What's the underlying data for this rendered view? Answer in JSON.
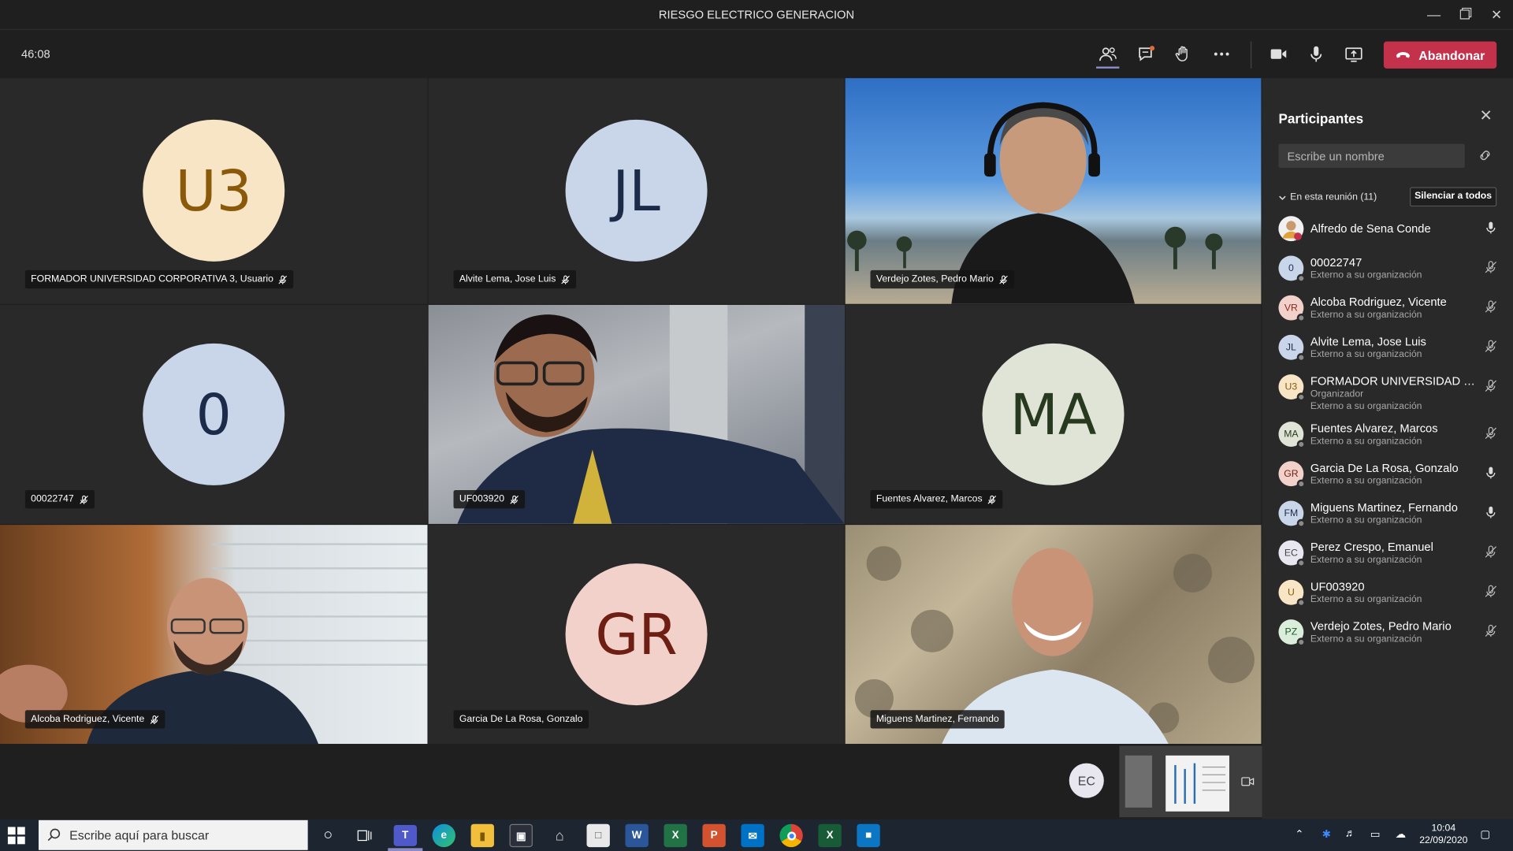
{
  "window": {
    "title": "RIESGO ELECTRICO GENERACION"
  },
  "meeting": {
    "timer": "46:08",
    "leave_label": "Abandonar"
  },
  "tiles": [
    {
      "name": "FORMADOR UNIVERSIDAD CORPORATIVA 3, Usuario",
      "initials": "U3",
      "bg": "#f7e5c5",
      "fg": "#8a5a0a",
      "type": "avatar",
      "muted": true
    },
    {
      "name": "Alvite Lema, Jose Luis",
      "initials": "JL",
      "bg": "#c9d6ea",
      "fg": "#1d2b4a",
      "type": "avatar",
      "muted": true
    },
    {
      "name": "Verdejo Zotes, Pedro Mario",
      "type": "video",
      "muted": true
    },
    {
      "name": "00022747",
      "initials": "0",
      "bg": "#c9d6ea",
      "fg": "#1d2b4a",
      "type": "avatar",
      "muted": true
    },
    {
      "name": "UF003920",
      "type": "video",
      "muted": true
    },
    {
      "name": "Fuentes Alvarez, Marcos",
      "initials": "MA",
      "bg": "#dfe4d7",
      "fg": "#27391e",
      "type": "avatar",
      "muted": true
    },
    {
      "name": "Alcoba Rodriguez, Vicente",
      "type": "video",
      "muted": true
    },
    {
      "name": "Garcia De La Rosa, Gonzalo",
      "initials": "GR",
      "bg": "#f2d1cb",
      "fg": "#6e1e12",
      "type": "avatar",
      "muted": false
    },
    {
      "name": "Miguens Martinez, Fernando",
      "type": "video",
      "muted": false
    }
  ],
  "strip": {
    "self_initials": "EC"
  },
  "panel": {
    "title": "Participantes",
    "search_placeholder": "Escribe un nombre",
    "in_meeting": "En esta reunión (11)",
    "mute_all": "Silenciar a todos",
    "participants": [
      {
        "name": "Alfredo de Sena Conde",
        "initials": "",
        "bg": "#f3f3f3",
        "fg": "#333",
        "subtitle": "",
        "subtitle2": "",
        "muted": false,
        "photo": true
      },
      {
        "name": "00022747",
        "initials": "0",
        "bg": "#c9d6ea",
        "fg": "#1d2b4a",
        "subtitle": "Externo a su organización",
        "subtitle2": "",
        "muted": true
      },
      {
        "name": "Alcoba Rodriguez, Vicente",
        "initials": "VR",
        "bg": "#f2d1cb",
        "fg": "#8b2a18",
        "subtitle": "Externo a su organización",
        "subtitle2": "",
        "muted": true
      },
      {
        "name": "Alvite Lema, Jose Luis",
        "initials": "JL",
        "bg": "#c9d6ea",
        "fg": "#1d2b4a",
        "subtitle": "Externo a su organización",
        "subtitle2": "",
        "muted": true
      },
      {
        "name": "FORMADOR UNIVERSIDAD COR...",
        "initials": "U3",
        "bg": "#f7e5c5",
        "fg": "#8a5a0a",
        "subtitle": "Organizador",
        "subtitle2": "Externo a su organización",
        "muted": true
      },
      {
        "name": "Fuentes Alvarez, Marcos",
        "initials": "MA",
        "bg": "#dfe4d7",
        "fg": "#27391e",
        "subtitle": "Externo a su organización",
        "subtitle2": "",
        "muted": true
      },
      {
        "name": "Garcia De La Rosa, Gonzalo",
        "initials": "GR",
        "bg": "#f2d1cb",
        "fg": "#6e1e12",
        "subtitle": "Externo a su organización",
        "subtitle2": "",
        "muted": false
      },
      {
        "name": "Miguens Martinez, Fernando",
        "initials": "FM",
        "bg": "#c9d6ea",
        "fg": "#1d2b4a",
        "subtitle": "Externo a su organización",
        "subtitle2": "",
        "muted": false
      },
      {
        "name": "Perez Crespo, Emanuel",
        "initials": "EC",
        "bg": "#e8e6ee",
        "fg": "#444",
        "subtitle": "Externo a su organización",
        "subtitle2": "",
        "muted": true
      },
      {
        "name": "UF003920",
        "initials": "U",
        "bg": "#f7e5c5",
        "fg": "#8a5a0a",
        "subtitle": "Externo a su organización",
        "subtitle2": "",
        "muted": true
      },
      {
        "name": "Verdejo Zotes, Pedro Mario",
        "initials": "PZ",
        "bg": "#dbeedb",
        "fg": "#1e5a2a",
        "subtitle": "Externo a su organización",
        "subtitle2": "",
        "muted": true
      }
    ]
  },
  "taskbar": {
    "search_placeholder": "Escribe aquí para buscar",
    "time": "10:04",
    "date": "22/09/2020"
  },
  "colors": {
    "accent": "#8b8cc7",
    "leave": "#c4314b"
  }
}
